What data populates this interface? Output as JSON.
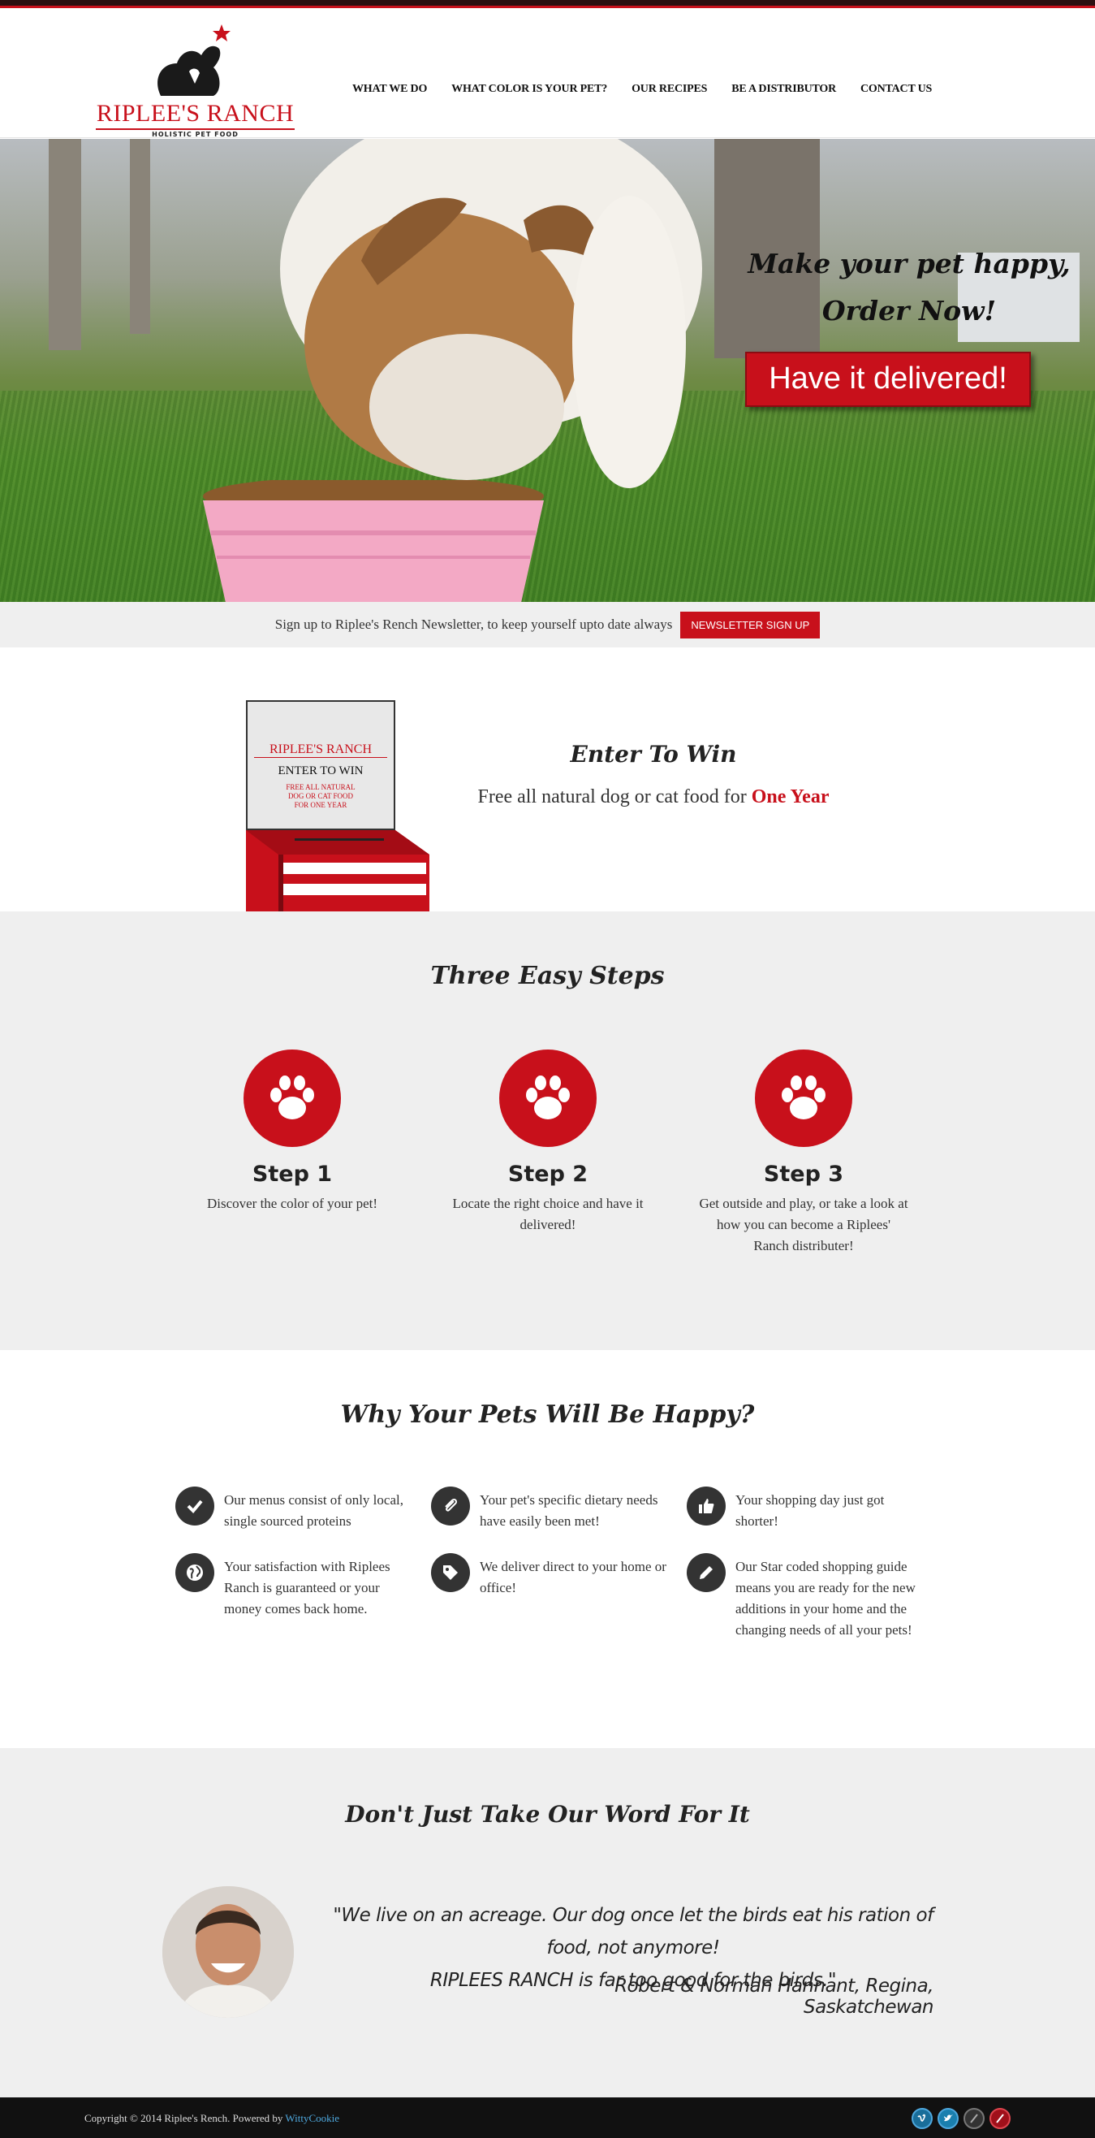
{
  "brand": {
    "name": "RIPLEE'S RANCH",
    "tagline": "HOLISTIC PET FOOD"
  },
  "nav": {
    "items": [
      "WHAT WE DO",
      "WHAT COLOR IS YOUR PET?",
      "OUR RECIPES",
      "BE A DISTRIBUTOR",
      "CONTACT US"
    ]
  },
  "hero": {
    "title_line1": "Make your pet happy,",
    "title_line2": "Order Now!",
    "cta": "Have it delivered!"
  },
  "newsletter": {
    "text": "Sign up to Riplee's Rench Newsletter, to keep yourself upto date always",
    "button": "NEWSLETTER SIGN UP"
  },
  "contest": {
    "box_brand": "RIPLEE'S RANCH",
    "box_heading": "ENTER TO WIN",
    "box_line1": "FREE ALL NATURAL",
    "box_line2": "DOG OR CAT FOOD",
    "box_line3": "FOR ONE YEAR",
    "title": "Enter To Win",
    "text": "Free all natural dog or cat food for",
    "highlight": "One Year"
  },
  "steps": {
    "title": "Three Easy Steps",
    "items": [
      {
        "title": "Step 1",
        "text": "Discover the color of your pet!"
      },
      {
        "title": "Step 2",
        "text": "Locate the right choice and have it delivered!"
      },
      {
        "title": "Step 3",
        "text": "Get outside and play, or take a look at how you can become a Riplees' Ranch distributer!"
      }
    ]
  },
  "why": {
    "title": "Why Your Pets Will Be Happy?",
    "features": [
      {
        "icon": "check-icon",
        "text": "Our menus consist of only local, single sourced proteins"
      },
      {
        "icon": "paperclip-icon",
        "text": "Your pet's specific dietary needs have easily been met!"
      },
      {
        "icon": "thumbs-up-icon",
        "text": "Your shopping day just got shorter!"
      },
      {
        "icon": "globe-icon",
        "text": "Your satisfaction with Riplees Ranch is guaranteed or your money comes back home."
      },
      {
        "icon": "tag-icon",
        "text": "We deliver direct to your home or office!"
      },
      {
        "icon": "pencil-icon",
        "text": "Our Star coded shopping guide means you are ready for the new additions in your home and the changing needs of all your pets!"
      }
    ]
  },
  "testimonial": {
    "title": "Don't Just Take Our Word For It",
    "quote_line1": "\"We live on an acreage. Our dog once let the birds eat his ration of food, not anymore!",
    "quote_line2": "RIPLEES RANCH is far too good for the birds.\"",
    "author": "Robert & Norman Hannant, Regina, Saskatchewan"
  },
  "footer": {
    "copyright": "Copyright © 2014 Riplee's Rench. Powered by",
    "powered_by": "WittyCookie",
    "social": [
      "vimeo-icon",
      "twitter-icon",
      "github-icon",
      "pinterest-icon"
    ]
  },
  "colors": {
    "accent": "#c8101b",
    "dark": "#111111",
    "panel": "#efefef"
  }
}
